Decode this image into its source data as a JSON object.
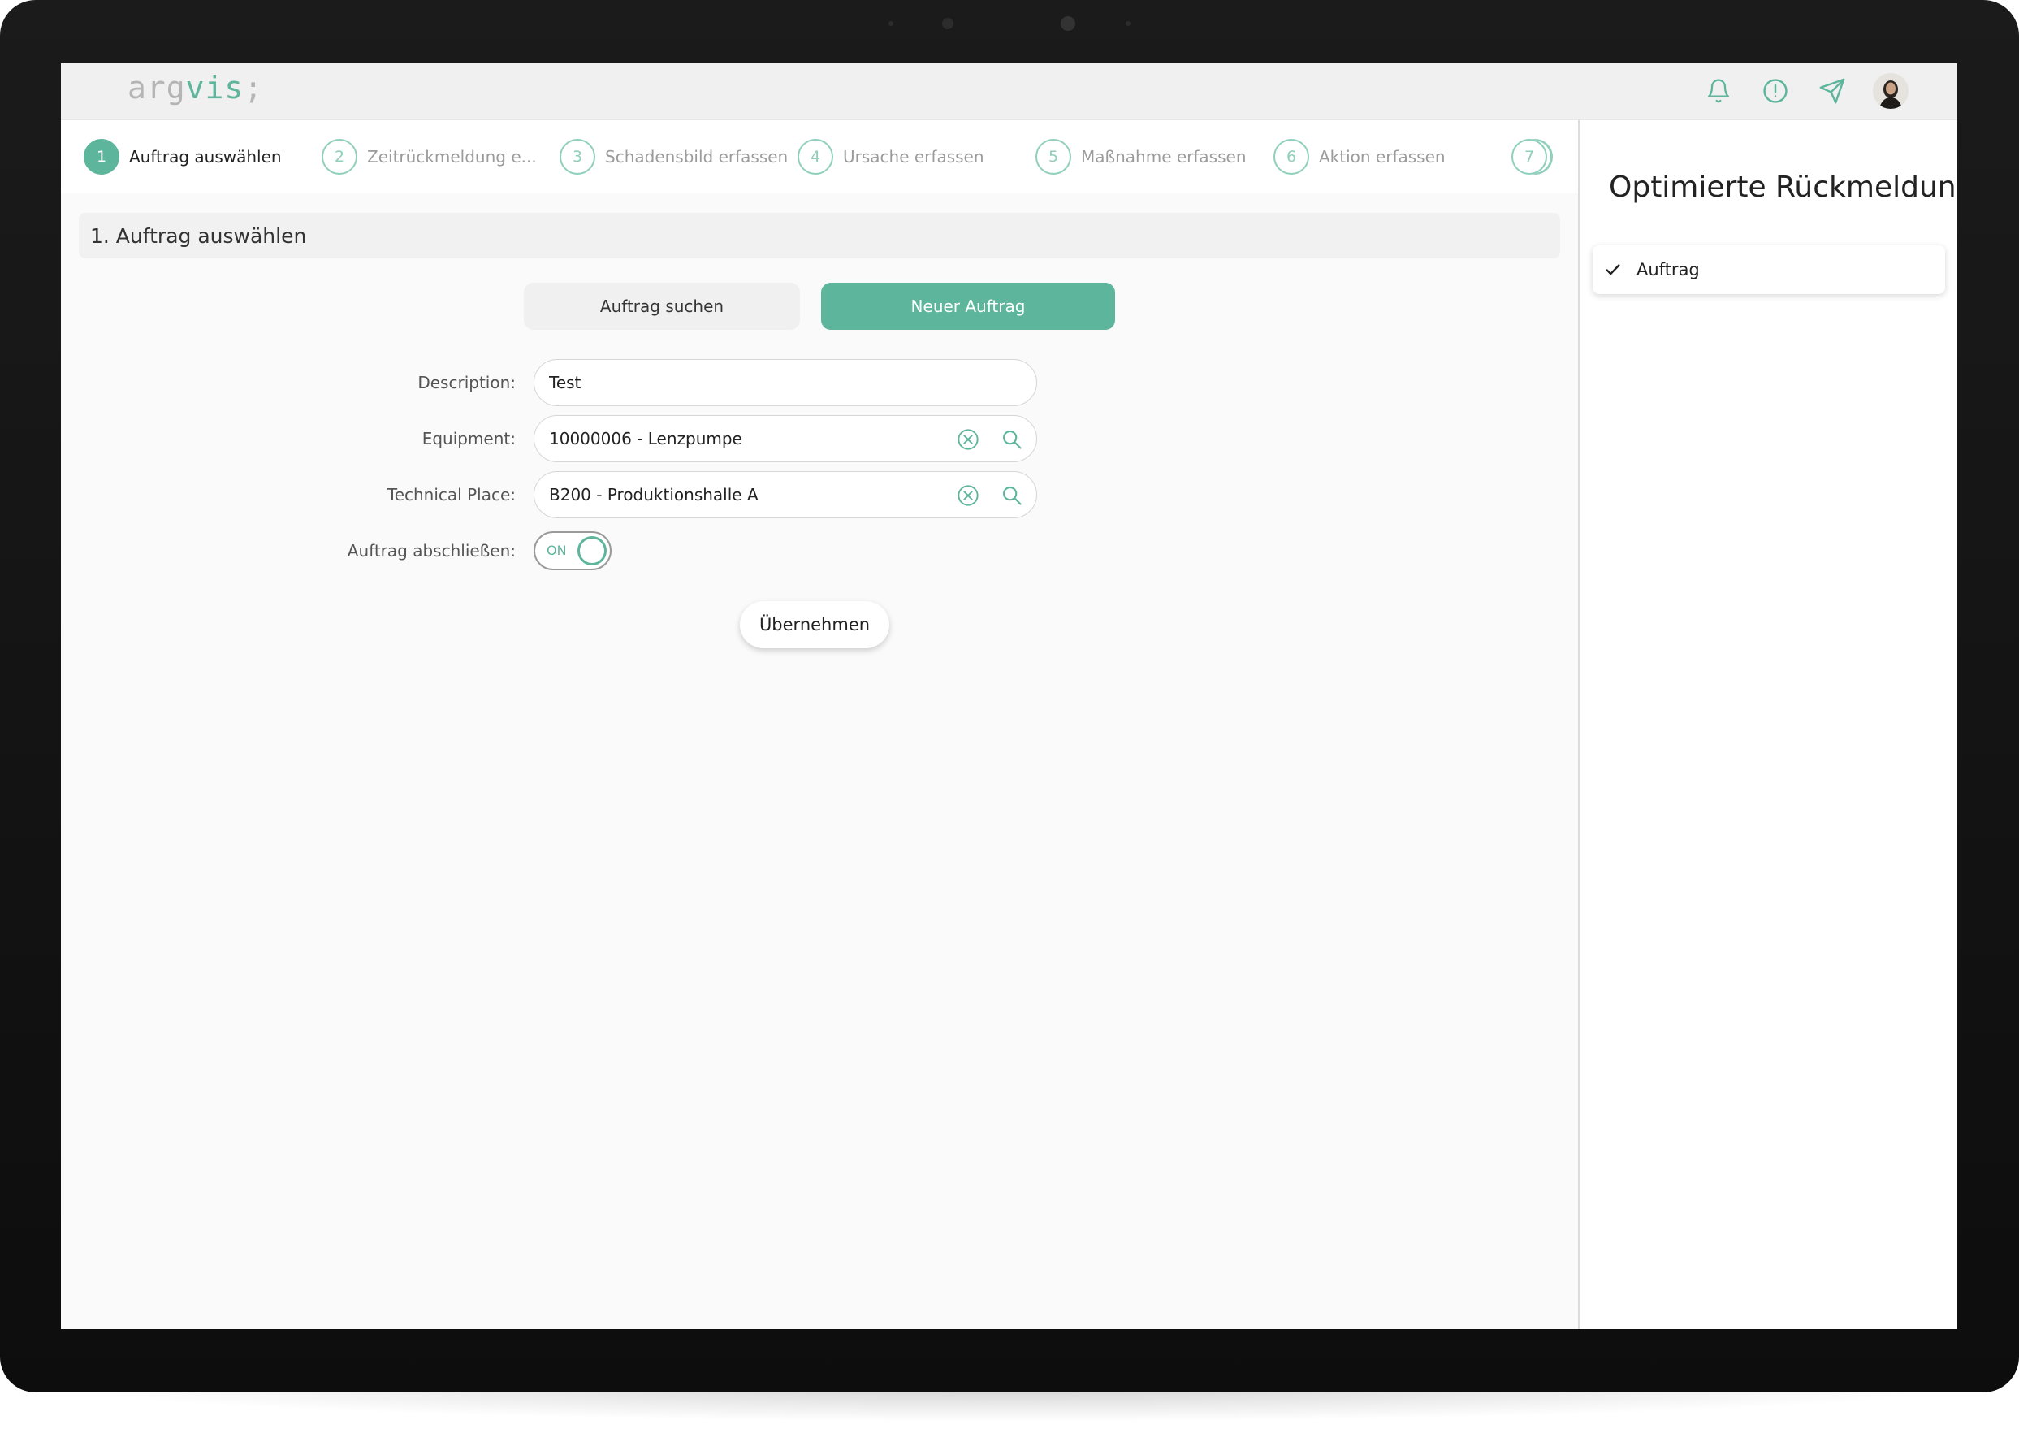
{
  "app": {
    "logo_text_gray": "arg",
    "logo_text_accent": "vis",
    "logo_text_tail": ";",
    "accent_color": "#5db59b"
  },
  "topbar": {
    "icons": [
      "bell-icon",
      "alert-icon",
      "send-icon",
      "avatar"
    ]
  },
  "stepper": {
    "steps": [
      {
        "number": "1",
        "label": "Auftrag auswählen",
        "active": true
      },
      {
        "number": "2",
        "label": "Zeitrückmeldung e...",
        "active": false
      },
      {
        "number": "3",
        "label": "Schadensbild erfassen",
        "active": false
      },
      {
        "number": "4",
        "label": "Ursache erfassen",
        "active": false
      },
      {
        "number": "5",
        "label": "Maßnahme erfassen",
        "active": false
      },
      {
        "number": "6",
        "label": "Aktion erfassen",
        "active": false
      },
      {
        "number": "7",
        "label": "",
        "active": false
      }
    ]
  },
  "section": {
    "title": "1. Auftrag auswählen"
  },
  "actions": {
    "search_label": "Auftrag suchen",
    "new_label": "Neuer Auftrag"
  },
  "form": {
    "description": {
      "label": "Description:",
      "value": "Test"
    },
    "equipment": {
      "label": "Equipment:",
      "value": "10000006 - Lenzpumpe"
    },
    "technical_place": {
      "label": "Technical Place:",
      "value": "B200 - Produktionshalle A"
    },
    "close_order": {
      "label": "Auftrag abschließen:",
      "toggle_text": "ON",
      "checked": true
    },
    "apply_label": "Übernehmen"
  },
  "sidepanel": {
    "title": "Optimierte Rückmeldung",
    "items": [
      {
        "label": "Auftrag",
        "checked": true
      }
    ]
  }
}
